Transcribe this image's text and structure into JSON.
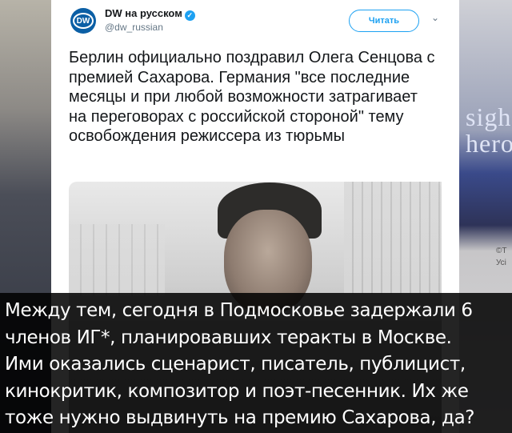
{
  "tweet": {
    "account_name": "DW на русском",
    "verified_mark": "✓",
    "handle": "@dw_russian",
    "avatar_text": "DW",
    "follow_label": "Читать",
    "menu_icon": "chevron-down-icon",
    "text": "Берлин официально поздравил Олега Сенцова с премией Сахарова. Германия \"все последние месяцы и при любой возможности затрагивает на переговорах с российской стороной\" тему освобождения режиссера из тюрьмы"
  },
  "background": {
    "right_sign": "sigh\nhero",
    "right_small": "©T\nУсі"
  },
  "caption_faint": "",
  "overlay": {
    "lines": [
      "Между тем, сегодня в Подмосковье задержали 6",
      "членов ИГ*, планировавших теракты в Москве.",
      "Ими оказались сценарист, писатель, публицист,",
      "кинокритик, композитор и поэт-песенник. Их же",
      "тоже нужно выдвинуть на премию Сахарова, да?"
    ]
  },
  "colors": {
    "twitter_blue": "#1da1f2",
    "dw_blue": "#0b5fa5",
    "overlay_bg": "#000000"
  }
}
